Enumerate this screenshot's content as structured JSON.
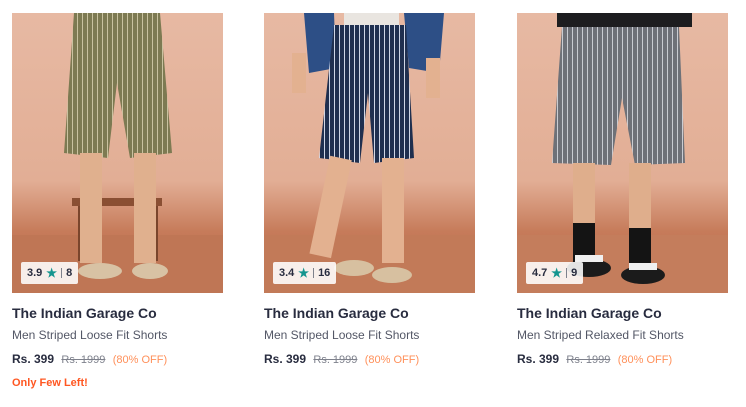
{
  "products": [
    {
      "brand": "The Indian Garage Co",
      "name": "Men Striped Loose Fit Shorts",
      "rating": "3.9",
      "rating_count": "8",
      "price": "Rs. 399",
      "mrp": "Rs. 1999",
      "discount": "(80% OFF)",
      "stock_note": "Only Few Left!",
      "shorts_color": "#7d7a52"
    },
    {
      "brand": "The Indian Garage Co",
      "name": "Men Striped Loose Fit Shorts",
      "rating": "3.4",
      "rating_count": "16",
      "price": "Rs. 399",
      "mrp": "Rs. 1999",
      "discount": "(80% OFF)",
      "shorts_color": "#1f2f4f"
    },
    {
      "brand": "The Indian Garage Co",
      "name": "Men Striped Relaxed Fit Shorts",
      "rating": "4.7",
      "rating_count": "9",
      "price": "Rs. 399",
      "mrp": "Rs. 1999",
      "discount": "(80% OFF)",
      "shorts_color": "#6e7178"
    }
  ],
  "icons": {
    "rating": "star-icon"
  },
  "colors": {
    "star": "#14958f",
    "discount": "#ff905a",
    "stock_note": "#ff5722"
  }
}
